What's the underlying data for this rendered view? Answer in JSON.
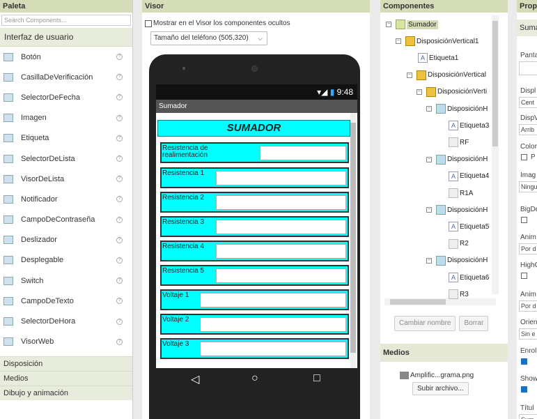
{
  "palette": {
    "header": "Paleta",
    "search_placeholder": "Search Components...",
    "category_ui": "Interfaz de usuario",
    "items": [
      {
        "label": "Botón",
        "icon": "button-icon"
      },
      {
        "label": "CasillaDeVerificación",
        "icon": "checkbox-icon"
      },
      {
        "label": "SelectorDeFecha",
        "icon": "date-picker-icon"
      },
      {
        "label": "Imagen",
        "icon": "image-icon"
      },
      {
        "label": "Etiqueta",
        "icon": "label-icon"
      },
      {
        "label": "SelectorDeLista",
        "icon": "list-picker-icon"
      },
      {
        "label": "VisorDeLista",
        "icon": "list-view-icon"
      },
      {
        "label": "Notificador",
        "icon": "notifier-icon"
      },
      {
        "label": "CampoDeContraseña",
        "icon": "password-icon"
      },
      {
        "label": "Deslizador",
        "icon": "slider-icon"
      },
      {
        "label": "Desplegable",
        "icon": "spinner-icon"
      },
      {
        "label": "Switch",
        "icon": "switch-icon"
      },
      {
        "label": "CampoDeTexto",
        "icon": "textbox-icon"
      },
      {
        "label": "SelectorDeHora",
        "icon": "time-picker-icon"
      },
      {
        "label": "VisorWeb",
        "icon": "web-viewer-icon"
      }
    ],
    "help_glyph": "?",
    "category_layout": "Disposición",
    "category_media": "Medios",
    "category_drawing": "Dibujo y animación"
  },
  "viewer": {
    "header": "Visor",
    "show_hidden_label": "Mostrar en el Visor los componentes ocultos",
    "phone_size": "Tamaño del teléfono (505,320)",
    "time": "9:48",
    "app_title": "Sumador",
    "screen_title": "SUMADOR",
    "rows": [
      "Resistencia de realimentación",
      "Resistencia 1",
      "Resistencia 2",
      "Resistencia 3",
      "Resistencia 4",
      "Resistencia 5",
      "Voltaje 1",
      "Voltaje 2",
      "Voltaje 3"
    ],
    "nav_back": "◁",
    "nav_home": "○",
    "nav_recent": "□"
  },
  "components": {
    "header": "Componentes",
    "tree": [
      {
        "label": "Sumador",
        "kind": "scr"
      },
      {
        "label": "DisposiciónVertical1",
        "kind": "va"
      },
      {
        "label": "Etiqueta1",
        "kind": "lb"
      },
      {
        "label": "DisposiciónVertical",
        "kind": "va"
      },
      {
        "label": "DisposiciónVerti",
        "kind": "va"
      },
      {
        "label": "DisposiciónH",
        "kind": "ha"
      },
      {
        "label": "Etiqueta3",
        "kind": "lb"
      },
      {
        "label": "RF",
        "kind": "tb"
      },
      {
        "label": "DisposiciónH",
        "kind": "ha"
      },
      {
        "label": "Etiqueta4",
        "kind": "lb"
      },
      {
        "label": "R1A",
        "kind": "tb"
      },
      {
        "label": "DisposiciónH",
        "kind": "ha"
      },
      {
        "label": "Etiqueta5",
        "kind": "lb"
      },
      {
        "label": "R2",
        "kind": "tb"
      },
      {
        "label": "DisposiciónH",
        "kind": "ha"
      },
      {
        "label": "Etiqueta6",
        "kind": "lb"
      },
      {
        "label": "R3",
        "kind": "tb"
      }
    ],
    "rename_button": "Cambiar nombre",
    "delete_button": "Borrar",
    "media_header": "Medios",
    "media_file": "Amplific...grama.png",
    "upload_button": "Subir archivo..."
  },
  "properties": {
    "header": "Prop",
    "tab": "Suma",
    "items": [
      {
        "label": "Panta",
        "value": ""
      },
      {
        "label": "Displ",
        "value": "Cent"
      },
      {
        "label": "DispV",
        "value": "Arrib"
      },
      {
        "label": "Color",
        "value": "P"
      },
      {
        "label": "Imag",
        "value": "Ningu"
      },
      {
        "label": "BigDe",
        "value": ""
      },
      {
        "label": "Anim",
        "value": "Por d"
      },
      {
        "label": "HighC",
        "value": ""
      },
      {
        "label": "Anim",
        "value": "Por d"
      },
      {
        "label": "Orien",
        "value": "Sin e"
      },
      {
        "label": "Enrol",
        "value": ""
      },
      {
        "label": "Show",
        "value": ""
      },
      {
        "label": "Títul",
        "value": "Sum"
      }
    ]
  }
}
